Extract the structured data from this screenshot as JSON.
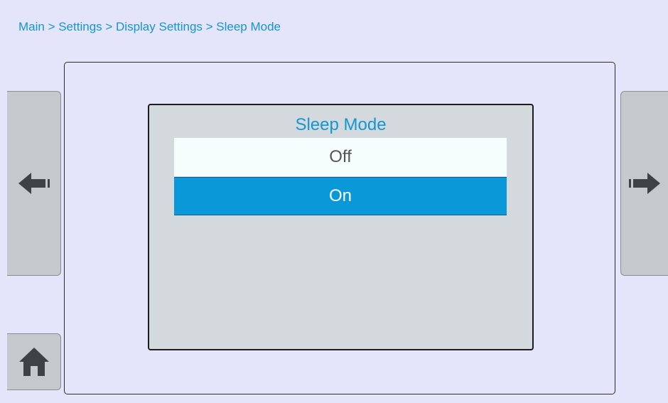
{
  "breadcrumb": {
    "text": "Main > Settings > Display Settings > Sleep Mode"
  },
  "dialog": {
    "title": "Sleep Mode",
    "options": [
      {
        "label": "Off",
        "selected": false
      },
      {
        "label": "On",
        "selected": true
      }
    ]
  },
  "nav": {
    "back_icon": "arrow-left-icon",
    "forward_icon": "arrow-right-icon",
    "home_icon": "home-icon"
  },
  "colors": {
    "accent": "#1496d2",
    "selected_bg": "#0a98d8",
    "dialog_bg": "#d3d9dc",
    "page_bg": "#e4e4fa",
    "button_bg": "#c5c9cc",
    "icon": "#3f4244"
  }
}
